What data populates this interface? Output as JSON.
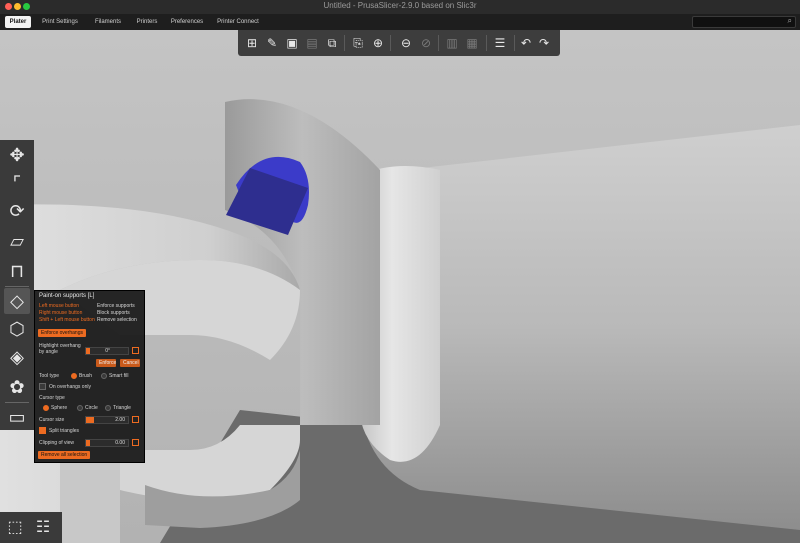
{
  "window": {
    "title": "Untitled - PrusaSlicer-2.9.0 based on Slic3r"
  },
  "tabs": [
    {
      "label": "Plater",
      "active": true
    },
    {
      "label": "Print Settings",
      "active": false
    },
    {
      "label": "Filaments",
      "active": false
    },
    {
      "label": "Printers",
      "active": false
    },
    {
      "label": "Preferences",
      "active": false
    },
    {
      "label": "Printer Connect",
      "active": false
    }
  ],
  "top_toolbar": {
    "icons": [
      "add-icon",
      "delete-icon",
      "delete-all-icon",
      "arrange-icon",
      "copy-icon",
      "paste-icon",
      "add-instance-icon",
      "remove-instance-icon",
      "split-objects-icon",
      "split-parts-icon",
      "variable-layer-height-icon",
      "undo-icon",
      "redo-icon"
    ]
  },
  "left_toolbar": {
    "icons": [
      "move-icon",
      "scale-icon",
      "rotate-icon",
      "place-on-face-icon",
      "cut-icon",
      "support-paint-icon",
      "seam-paint-icon",
      "mmu-paint-icon",
      "measure-icon",
      "emboss-icon"
    ]
  },
  "panel": {
    "title": "Paint-on supports [L]",
    "rows": [
      {
        "key": "Left mouse button",
        "value": "Enforce supports"
      },
      {
        "key": "Right mouse button",
        "value": "Block supports"
      },
      {
        "key": "Shift + Left mouse button",
        "value": "Remove selection"
      }
    ],
    "enforce_overhangs_button": "Enforce overhangs",
    "highlight_label_line1": "Highlight overhang",
    "highlight_label_line2": "by angle",
    "angle_value": "0°",
    "enforce_btn": "Enforce",
    "cancel_btn": "Cancel",
    "tool_type_label": "Tool type",
    "tool_brush": "Brush",
    "tool_smart_fill": "Smart fill",
    "on_overhangs_only": "On overhangs only",
    "cursor_label": "Cursor type",
    "cursor_sphere": "Sphere",
    "cursor_circle": "Circle",
    "cursor_triangle": "Triangle",
    "cursor_size_label": "Cursor size",
    "cursor_size_value": "2.00",
    "split_triangles": "Split triangles",
    "clipping_label": "Clipping of view",
    "clipping_value": "0.00",
    "remove_all_button": "Remove all selection"
  },
  "colors": {
    "accent": "#ed6b21",
    "paint": "#3b3bc9"
  }
}
